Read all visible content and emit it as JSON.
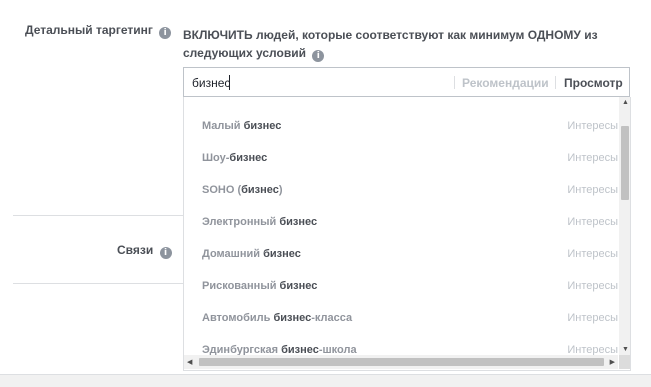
{
  "detail_label": "Детальный таргетинг",
  "links_label": "Связи",
  "instruction": "ВКЛЮЧИТЬ людей, которые соответствуют как минимум ОДНОМУ из следующих условий",
  "search": {
    "value": "бизнес"
  },
  "tabs": {
    "recommendations": "Рекомендации",
    "browse": "Просмотр"
  },
  "info_glyph": "i",
  "items": [
    {
      "before": "Малый ",
      "bold": "бизнес",
      "after": "",
      "type": "Интересы"
    },
    {
      "before": "Шоу-",
      "bold": "бизнес",
      "after": "",
      "type": "Интересы"
    },
    {
      "before": "SOHO (",
      "bold": "бизнес",
      "after": ")",
      "type": "Интересы"
    },
    {
      "before": "Электронный ",
      "bold": "бизнес",
      "after": "",
      "type": "Интересы"
    },
    {
      "before": "Домашний ",
      "bold": "бизнес",
      "after": "",
      "type": "Интересы"
    },
    {
      "before": "Рискованный ",
      "bold": "бизнес",
      "after": "",
      "type": "Интересы"
    },
    {
      "before": "Автомобиль ",
      "bold": "бизнес",
      "after": "-класса",
      "type": "Интересы"
    },
    {
      "before": "Эдинбургская ",
      "bold": "бизнес",
      "after": "-школа",
      "type": "Интересы"
    }
  ]
}
